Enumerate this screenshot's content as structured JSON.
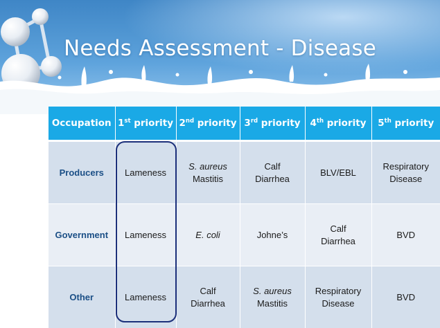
{
  "slide": {
    "title": "Needs Assessment - Disease"
  },
  "table": {
    "headers": [
      {
        "main": "Occupation",
        "sup": "",
        "rest": ""
      },
      {
        "main": "1",
        "sup": "st",
        "rest": " priority"
      },
      {
        "main": "2",
        "sup": "nd",
        "rest": " priority"
      },
      {
        "main": "3",
        "sup": "rd",
        "rest": " priority"
      },
      {
        "main": "4",
        "sup": "th",
        "rest": " priority"
      },
      {
        "main": "5",
        "sup": "th",
        "rest": " priority"
      }
    ],
    "rows": [
      {
        "occupation": "Producers",
        "cells": [
          {
            "l1": "Lameness",
            "l2": "",
            "italic": ""
          },
          {
            "l1": "",
            "l2": "Mastitis",
            "italic": "S. aureus"
          },
          {
            "l1": "Calf",
            "l2": "Diarrhea",
            "italic": ""
          },
          {
            "l1": "BLV/EBL",
            "l2": "",
            "italic": ""
          },
          {
            "l1": "Respiratory",
            "l2": "Disease",
            "italic": ""
          }
        ]
      },
      {
        "occupation": "Government",
        "cells": [
          {
            "l1": "Lameness",
            "l2": "",
            "italic": ""
          },
          {
            "l1": "",
            "l2": "",
            "italic": "E. coli"
          },
          {
            "l1": "Johne’s",
            "l2": "",
            "italic": ""
          },
          {
            "l1": "Calf",
            "l2": "Diarrhea",
            "italic": ""
          },
          {
            "l1": "BVD",
            "l2": "",
            "italic": ""
          }
        ]
      },
      {
        "occupation": "Other",
        "cells": [
          {
            "l1": "Lameness",
            "l2": "",
            "italic": ""
          },
          {
            "l1": "Calf",
            "l2": "Diarrhea",
            "italic": ""
          },
          {
            "l1": "",
            "l2": "Mastitis",
            "italic": "S. aureus"
          },
          {
            "l1": "Respiratory",
            "l2": "Disease",
            "italic": ""
          },
          {
            "l1": "BVD",
            "l2": "",
            "italic": ""
          }
        ]
      }
    ]
  },
  "colors": {
    "header_blue": "#1aa9e6",
    "row_label_blue": "#1b4f86",
    "highlight_border": "#1b2f7a",
    "row_shade_dark": "#d4dfec",
    "row_shade_light": "#e9eef5"
  }
}
